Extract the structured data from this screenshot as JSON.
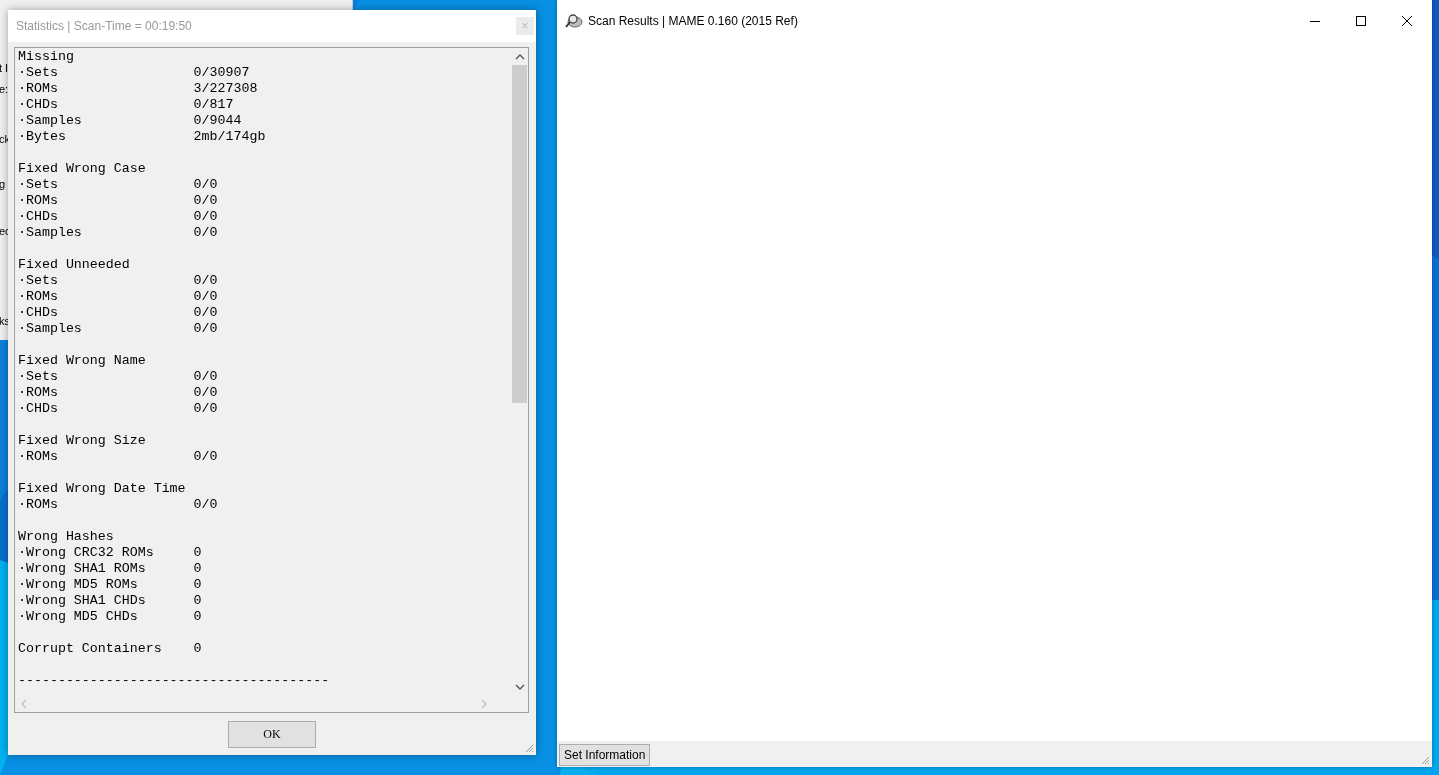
{
  "background_window": {
    "fragments": [
      "t I",
      "e:",
      "ck",
      "g",
      "ec",
      "ks"
    ]
  },
  "statistics_window": {
    "title": "Statistics | Scan-Time = 00:19:50",
    "close_button": "×",
    "sections": [
      {
        "title": "Missing",
        "rows": [
          {
            "label": "·Sets",
            "value": "0/30907"
          },
          {
            "label": "·ROMs",
            "value": "3/227308"
          },
          {
            "label": "·CHDs",
            "value": "0/817"
          },
          {
            "label": "·Samples",
            "value": "0/9044"
          },
          {
            "label": "·Bytes",
            "value": "2mb/174gb"
          }
        ]
      },
      {
        "title": "Fixed Wrong Case",
        "rows": [
          {
            "label": "·Sets",
            "value": "0/0"
          },
          {
            "label": "·ROMs",
            "value": "0/0"
          },
          {
            "label": "·CHDs",
            "value": "0/0"
          },
          {
            "label": "·Samples",
            "value": "0/0"
          }
        ]
      },
      {
        "title": "Fixed Unneeded",
        "rows": [
          {
            "label": "·Sets",
            "value": "0/0"
          },
          {
            "label": "·ROMs",
            "value": "0/0"
          },
          {
            "label": "·CHDs",
            "value": "0/0"
          },
          {
            "label": "·Samples",
            "value": "0/0"
          }
        ]
      },
      {
        "title": "Fixed Wrong Name",
        "rows": [
          {
            "label": "·Sets",
            "value": "0/0"
          },
          {
            "label": "·ROMs",
            "value": "0/0"
          },
          {
            "label": "·CHDs",
            "value": "0/0"
          }
        ]
      },
      {
        "title": "Fixed Wrong Size",
        "rows": [
          {
            "label": "·ROMs",
            "value": "0/0"
          }
        ]
      },
      {
        "title": "Fixed Wrong Date Time",
        "rows": [
          {
            "label": "·ROMs",
            "value": "0/0"
          }
        ]
      },
      {
        "title": "Wrong Hashes",
        "rows": [
          {
            "label": "·Wrong CRC32 ROMs",
            "value": "0"
          },
          {
            "label": "·Wrong SHA1 ROMs",
            "value": "0"
          },
          {
            "label": "·Wrong MD5 ROMs",
            "value": "0"
          },
          {
            "label": "·Wrong SHA1 CHDs",
            "value": "0"
          },
          {
            "label": "·Wrong MD5 CHDs",
            "value": "0"
          }
        ]
      },
      {
        "title": "Corrupt Containers",
        "value": "0"
      }
    ],
    "separator": "---------------------------------------",
    "ok_button": "OK"
  },
  "scan_results_window": {
    "title": "Scan Results | MAME 0.160 (2015 Ref)",
    "status_button": "Set Information"
  }
}
